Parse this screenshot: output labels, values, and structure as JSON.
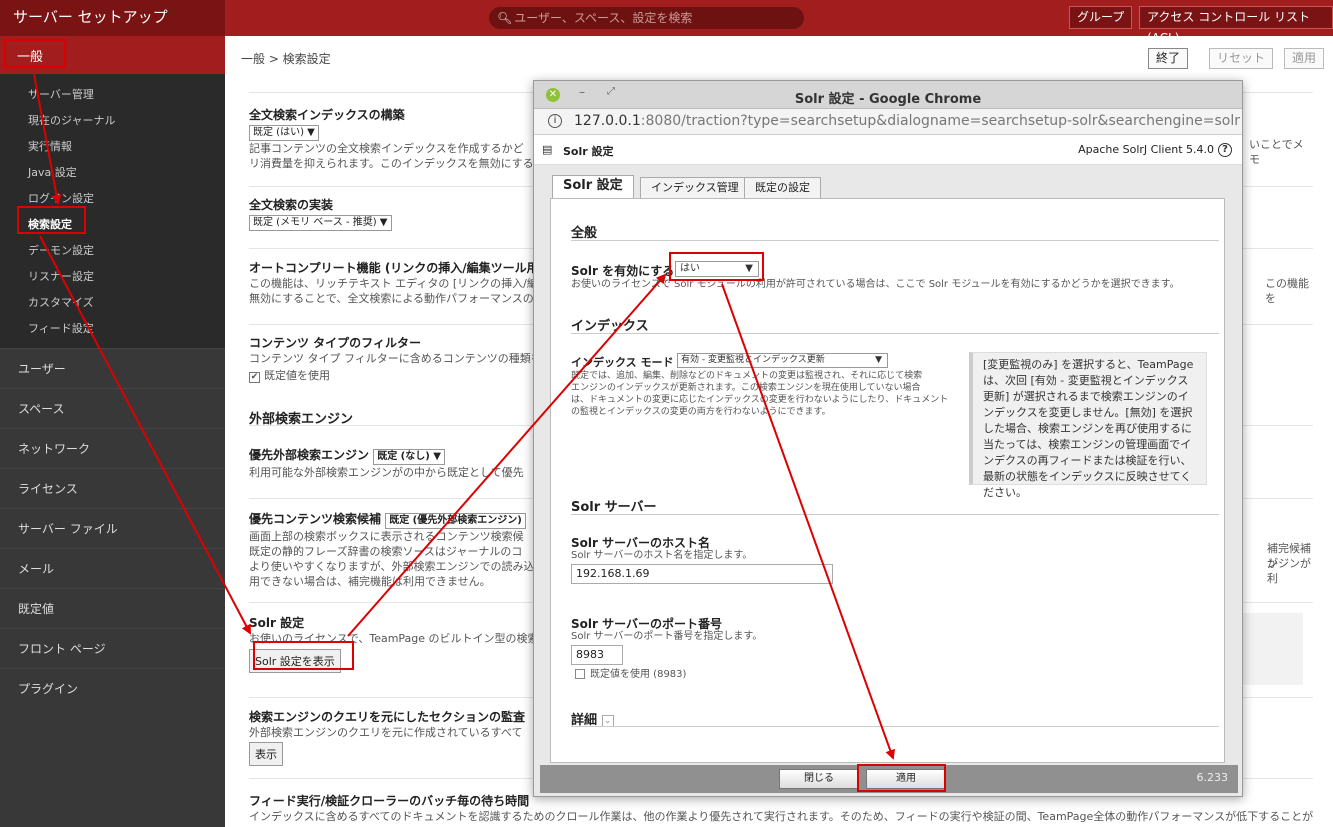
{
  "topbar": {
    "title": "サーバー セットアップ",
    "search_placeholder": "ユーザー、スペース、設定を検索",
    "groups_btn": "グループ",
    "acl_btn": "アクセス コントロール リスト (ACL)"
  },
  "sidebar": {
    "active_head": "一般",
    "sub_items": [
      "サーバー管理",
      "現在のジャーナル",
      "実行情報",
      "Java 設定",
      "ログイン設定",
      "検索設定",
      "デーモン設定",
      "リスナー設定",
      "カスタマイズ",
      "フィード設定"
    ],
    "items": [
      "ユーザー",
      "スペース",
      "ネットワーク",
      "ライセンス",
      "サーバー ファイル",
      "メール",
      "既定値",
      "フロント ページ",
      "プラグイン"
    ]
  },
  "main": {
    "breadcrumb": "一般 > 検索設定",
    "finish_btn": "終了",
    "reset_btn": "リセット",
    "apply_btn": "適用",
    "s1": {
      "title": "全文検索インデックスの構築",
      "select": "既定 (はい) ▼",
      "desc1": "記事コンテンツの全文検索インデックスを作成するかど",
      "desc2": "リ消費量を抑えられます。このインデックスを無効にする",
      "desc_right": "いことでメモ"
    },
    "s2": {
      "title": "全文検索の実装",
      "select": "既定 (メモリ ベース - 推奨) ▼"
    },
    "s3": {
      "title": "オートコンプリート機能 (リンクの挿入/編集ツール用",
      "desc1": "この機能は、リッチテキスト エディタの [リンクの挿入/編集",
      "desc2": "無効にすることで、全文検索による動作パフォーマンスの",
      "desc_right": "この機能を"
    },
    "s4": {
      "title": "コンテンツ タイプのフィルター",
      "desc": "コンテンツ タイプ フィルターに含めるコンテンツの種類を",
      "check_label": "既定値を使用"
    },
    "ext_heading": "外部検索エンジン",
    "s5": {
      "title": "優先外部検索エンジン",
      "select": "既定 (なし) ▼",
      "desc": "利用可能な外部検索エンジンがの中から既定として優先"
    },
    "s6": {
      "title": "優先コンテンツ検索候補",
      "select": "既定 (優先外部検索エンジン)",
      "desc1": "画面上部の検索ボックスに表示されるコンテンツ検索候",
      "desc2": "既定の静的フレーズ辞書の検索ソースはジャーナルのコ",
      "desc3": "より使いやすくなりますが、外部検索エンジンでの読み込",
      "desc4": "用できない場合は、補完機能は利用できません。",
      "desc_right1": "補完候補が",
      "desc_right2": "ンジンが利"
    },
    "s7": {
      "title": "Solr 設定",
      "desc": "お使いのライセンスで、TeamPage のビルトイン型の検索",
      "button": "Solr 設定を表示"
    },
    "s8": {
      "title": "検索エンジンのクエリを元にしたセクションの監査",
      "desc": "外部検索エンジンのクエリを元に作成されているすべて",
      "button": "表示"
    },
    "s9": {
      "title": "フィード実行/検証クローラーのバッチ毎の待ち時間",
      "desc": "インデックスに含めるすべてのドキュメントを認識するためのクロール作業は、他の作業より優先されて実行されます。そのため、フィードの実行や検証の間、TeamPage全体の動作パフォーマンスが低下することが"
    }
  },
  "dialog": {
    "window_title": "Solr 設定 - Google Chrome",
    "url_host": "127.0.0.1",
    "url_rest": ":8080/traction?type=searchsetup&dialogname=searchsetup-solr&searchengine=solr",
    "header_title": "Solr 設定",
    "header_version": "Apache SolrJ Client 5.4.0",
    "tabs": [
      "Solr 設定",
      "インデックス管理",
      "既定の設定"
    ],
    "general_heading": "全般",
    "enable_label": "Solr を有効にする",
    "enable_value": "はい",
    "enable_desc": "お使いのライセンスで Solr モジュールの利用が許可されている場合は、ここで Solr モジュールを有効にするかどうかを選択できます。",
    "index_heading": "インデックス",
    "index_mode_label": "インデックス モード",
    "index_mode_value": "有効 - 変更監視とインデックス更新",
    "index_desc1": "既定では、追加、編集、削除などのドキュメントの変更は監視され、それに応じて検索",
    "index_desc2": "エンジンのインデックスが更新されます。この検索エンジンを現在使用していない場合",
    "index_desc3": "は、ドキュメントの変更に応じたインデックスの変更を行わないようにしたり、ドキュメント",
    "index_desc4": "の監視とインデックスの変更の両方を行わないようにできます。",
    "info_text": "[変更監視のみ] を選択すると、TeamPage は、次回 [有効 - 変更監視とインデックス更新] が選択されるまで検索エンジンのインデックスを変更しません。[無効] を選択した場合、検索エンジンを再び使用するに当たっては、検索エンジンの管理画面でインデクスの再フィードまたは検証を行い、最新の状態をインデックスに反映させてください。",
    "server_heading": "Solr サーバー",
    "host_label": "Solr サーバーのホスト名",
    "host_desc": "Solr サーバーのホスト名を指定します。",
    "host_value": "192.168.1.69",
    "port_label": "Solr サーバーのポート番号",
    "port_desc": "Solr サーバーのポート番号を指定します。",
    "port_value": "8983",
    "port_default_label": "既定値を使用 (8983)",
    "details_heading": "詳細",
    "close_btn": "閉じる",
    "apply_btn": "適用",
    "version": "6.233"
  },
  "colors": {
    "brand": "#a21e1e",
    "annotation": "#dd0000"
  }
}
